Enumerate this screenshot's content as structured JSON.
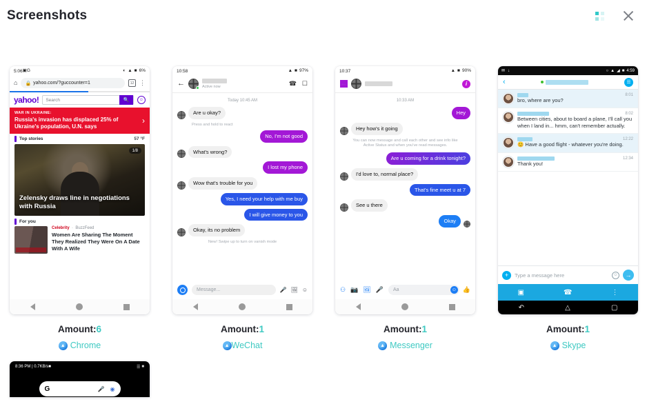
{
  "header": {
    "title": "Screenshots",
    "grid_icon": "grid-view-icon",
    "close_icon": "close-icon"
  },
  "cards": [
    {
      "app": "Chrome",
      "amount_label": "Amount:",
      "amount_value": "6",
      "status": {
        "time": "5:06",
        "battery": "6%",
        "icons": "image-icon google-icon dnd-icon wifi-icon battery-icon"
      },
      "omnibox": {
        "url": "yahoo.com/?guccounter=1",
        "tabs_count": "12",
        "home_icon": "home-icon",
        "lock_icon": "lock-icon",
        "menu_icon": "kebab-menu-icon"
      },
      "yahoo": {
        "logo": "yahoo!",
        "search_placeholder": "Search",
        "search_icon": "search-icon",
        "account_icon": "account-icon"
      },
      "banner": {
        "kicker": "WAR IN UKRAINE:",
        "headline": "Russia's invasion has displaced 25% of Ukraine's population, U.N. says",
        "arrow": "›"
      },
      "top_stories": {
        "label": "Top stories",
        "temp": "57 °F"
      },
      "hero": {
        "badge": "1/8",
        "title": "Zelensky draws line in negotiations with Russia"
      },
      "for_you": {
        "label": "For you",
        "category": "Celebrity",
        "source": "BuzzFeed",
        "headline": "Women Are Sharing The Moment They Realized They Were On A Date With A Wife"
      }
    },
    {
      "app": "WeChat",
      "amount_label": "Amount:",
      "amount_value": "1",
      "status": {
        "time": "10:58",
        "battery": "97%"
      },
      "topbar": {
        "back_icon": "back-arrow-icon",
        "presence": "Active now",
        "call_icon": "phone-call-icon",
        "video_icon": "video-call-icon"
      },
      "day_stamp": "Today 10:45 AM",
      "messages": [
        {
          "side": "in",
          "text": "Are u okay?"
        },
        {
          "side": "hint",
          "text": "Press and hold to react"
        },
        {
          "side": "out",
          "text": "No, I'm not good",
          "color": "purple"
        },
        {
          "side": "in",
          "text": "What's wrong?"
        },
        {
          "side": "out",
          "text": "I lost my phone",
          "color": "purple"
        },
        {
          "side": "in",
          "text": "Wow that's trouble for you"
        },
        {
          "side": "out",
          "text": "Yes, I need your help with me buy",
          "color": "blue"
        },
        {
          "side": "out",
          "text": "I will give money to you",
          "color": "blue"
        },
        {
          "side": "in",
          "text": "Okay, its no problem"
        }
      ],
      "footer_hint": "New! Swipe up to turn on vanish mode",
      "composer": {
        "placeholder": "Message...",
        "camera_icon": "camera-icon",
        "mic_icon": "microphone-icon",
        "gallery_icon": "gallery-icon",
        "sticker_icon": "sticker-icon"
      }
    },
    {
      "app": "Messenger",
      "amount_label": "Amount:",
      "amount_value": "1",
      "status": {
        "time": "10:37",
        "battery": "90%"
      },
      "topbar": {
        "back_icon": "back-arrow-icon",
        "info_icon": "info-icon"
      },
      "day_stamp": "10:33 AM",
      "messages": [
        {
          "side": "out",
          "text": "Hey",
          "color": "purple"
        },
        {
          "side": "in",
          "text": "Hey how's it going"
        },
        {
          "side": "note",
          "text": "You can now message and call each other and see info like Active Status and when you've read messages."
        },
        {
          "side": "out",
          "text": "Are u coming for a drink tonight?",
          "color": "purple-grad"
        },
        {
          "side": "in",
          "text": "I'd love to, normal place?"
        },
        {
          "side": "out",
          "text": "That's fine meet u at 7",
          "color": "blue"
        },
        {
          "side": "in",
          "text": "See u there"
        },
        {
          "side": "out",
          "text": "Okay",
          "color": "blue-light"
        }
      ],
      "toolbar": {
        "placeholder": "Aa",
        "apps_icon": "apps-grid-icon",
        "camera_icon": "camera-icon",
        "gallery_icon": "gallery-icon",
        "mic_icon": "microphone-icon",
        "emoji_icon": "emoji-icon",
        "like_icon": "thumbs-up-icon"
      }
    },
    {
      "app": "Skype",
      "amount_label": "Amount:",
      "amount_value": "1",
      "status": {
        "time": "4:59",
        "mail_icon": "mail-icon",
        "download-icon": "download-icon",
        "wifi_icon": "wifi-icon",
        "battery_icon": "battery-icon"
      },
      "topbar": {
        "back_icon": "back-arrow-icon",
        "chat_icon": "chat-icon",
        "presence": "online"
      },
      "messages": [
        {
          "time": "8:01",
          "text": "bro, where are you?",
          "highlight": true
        },
        {
          "time": "8:02",
          "text": "Between cities, about to board a plane, I'll call you when I land in... hmm, can't remember actually.",
          "highlight": false
        },
        {
          "time": "12:22",
          "text": "😊 Have a good flight - whatever you're doing.",
          "highlight": true
        },
        {
          "time": "12:34",
          "text": "Thank you!",
          "highlight": false
        }
      ],
      "composer": {
        "placeholder": "Type a message here",
        "plus_icon": "plus-icon",
        "emoji_icon": "emoji-icon",
        "send_icon": "send-arrow-icon"
      },
      "actionbar": {
        "video_icon": "video-call-icon",
        "call_icon": "phone-call-icon",
        "more_icon": "kebab-menu-icon"
      }
    }
  ],
  "partial_card": {
    "status": {
      "time": "8:36 PM | 0.7KB/s",
      "signal": "signal-icon"
    },
    "search": {
      "logo": "G",
      "mic_icon": "microphone-icon",
      "lens_icon": "google-lens-icon"
    }
  }
}
